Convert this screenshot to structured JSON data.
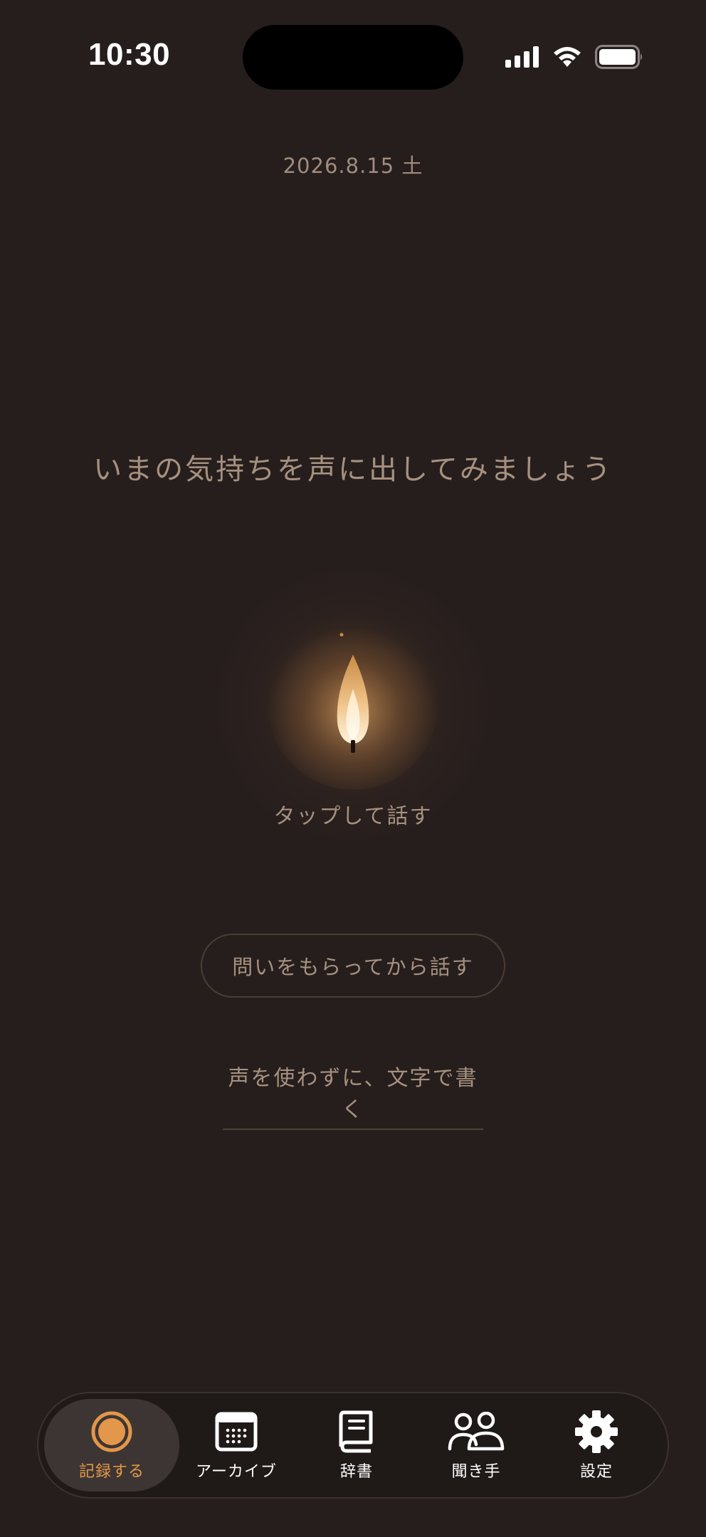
{
  "status_bar": {
    "time": "10:30"
  },
  "header": {
    "date": "2026.8.15 土"
  },
  "main": {
    "prompt": "いまの気持ちを声に出してみましょう",
    "tap_label": "タップして話す",
    "question_button": "問いをもらってから話す",
    "text_link": "声を使わずに、文字で書く"
  },
  "tabbar": {
    "items": [
      {
        "label": "記録する",
        "icon": "record-icon",
        "active": true
      },
      {
        "label": "アーカイブ",
        "icon": "calendar-icon",
        "active": false
      },
      {
        "label": "辞書",
        "icon": "book-icon",
        "active": false
      },
      {
        "label": "聞き手",
        "icon": "people-icon",
        "active": false
      },
      {
        "label": "設定",
        "icon": "gear-icon",
        "active": false
      }
    ]
  },
  "colors": {
    "background": "#261e1d",
    "accent": "#e3974a",
    "muted_text": "#a6917f"
  }
}
